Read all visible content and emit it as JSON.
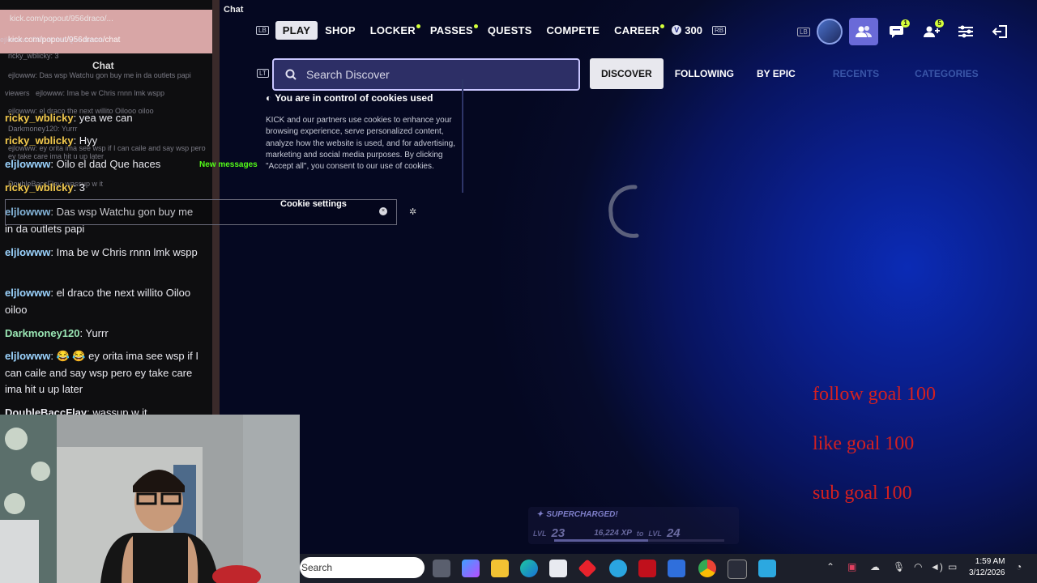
{
  "nav": {
    "kb_left": "LB",
    "kb_right": "RB",
    "items": [
      {
        "label": "PLAY",
        "active": true,
        "dot": false
      },
      {
        "label": "SHOP",
        "active": false,
        "dot": false
      },
      {
        "label": "LOCKER",
        "active": false,
        "dot": true
      },
      {
        "label": "PASSES",
        "active": false,
        "dot": true
      },
      {
        "label": "QUESTS",
        "active": false,
        "dot": false
      },
      {
        "label": "COMPETE",
        "active": false,
        "dot": false
      },
      {
        "label": "CAREER",
        "active": false,
        "dot": true
      }
    ],
    "vbucks": "300"
  },
  "topright": {
    "kb_left": "LB",
    "chat_badge": "1",
    "party_badge": "5",
    "icons": [
      "avatar",
      "friends-icon",
      "chat-icon",
      "party-icon",
      "settings-icon",
      "exit-icon"
    ]
  },
  "search": {
    "kb": "LT",
    "placeholder": "Search Discover"
  },
  "discover_tabs": [
    {
      "label": "DISCOVER",
      "active": true
    },
    {
      "label": "FOLLOWING",
      "active": false
    },
    {
      "label": "BY EPIC",
      "active": false
    },
    {
      "label": "RECENTS",
      "active": false
    },
    {
      "label": "CATEGORIES",
      "active": false
    }
  ],
  "cookie": {
    "title": "You are in control of cookies used",
    "text": "KICK and our partners use cookies to enhance your browsing experience, serve personalized content, analyze how the website is used, and for advertising, marketing and social media purposes. By clicking \"Accept all\", you consent to our use of cookies.",
    "settings_label": "Cookie settings"
  },
  "goals": [
    "follow goal 100",
    "like goal 100",
    "sub goal 100"
  ],
  "xp": {
    "supercharged": "SUPERCHARGED!",
    "lvl_label": "LVL",
    "level": "23",
    "xp_text": "16,224 XP",
    "to_text": "to",
    "next_lvl_label": "LVL",
    "next_level": "24",
    "progress": 0.55
  },
  "browser": {
    "tab_title": "kick.com/popout/956draco/...",
    "url": "kick.com/popout/956draco/chat",
    "window_label": "Chat",
    "chat_header": "Chat",
    "new_messages": "New messages"
  },
  "ghost_lines": [
    "ejlowww: Oilo el dad Que haces",
    "ricky_wblicky: 3",
    "ejlowww: Das wsp Watchu gon buy me in da outlets papi",
    "viewers",
    "ejlowww: Ima be w Chris rnnn lmk wspp",
    "ejlowww: el draco the next willito Oilooo oiloo",
    "Darkmoney120: Yurrr",
    "ejlowww: ey orita ima see wsp if I can caile and say wsp pero ey take care ima hit u up later",
    "DoubleBaccFlay: wassup w it"
  ],
  "messages": [
    {
      "user": "ricky_wblicky",
      "color": "y",
      "text": "yea we can"
    },
    {
      "user": "ricky_wblicky",
      "color": "y",
      "text": "Hyy"
    },
    {
      "user": "eljlowww",
      "color": "b",
      "text": "Oilo el dad Que haces"
    },
    {
      "user": "ricky_wblicky",
      "color": "y",
      "text": "3"
    },
    {
      "user": "eljlowww",
      "color": "b",
      "text": "Das wsp Watchu gon buy me in da outlets papi"
    },
    {
      "user": "eljlowww",
      "color": "b",
      "text": "Ima be w Chris rnnn lmk wspp"
    },
    {
      "user": "eljlowww",
      "color": "b",
      "text": "el draco the next willito Oiloo oiloo"
    },
    {
      "user": "Darkmoney120",
      "color": "g",
      "text": "Yurrr"
    },
    {
      "user": "eljlowww",
      "color": "b",
      "text": "😂 😂 ey orita ima see wsp if I can caile and say wsp pero ey take care ima hit u up later"
    },
    {
      "user": "DoubleBaccFlay",
      "color": "v",
      "text": "wassup w it"
    }
  ],
  "taskbar": {
    "search_placeholder": "Search",
    "time": "1:59 AM",
    "date": "3/12/2026"
  },
  "colors": {
    "accent": "#6a6ad8",
    "goal_red": "#d42020",
    "kick_green": "#53fc18",
    "badge_lime": "#d4ff3a"
  }
}
